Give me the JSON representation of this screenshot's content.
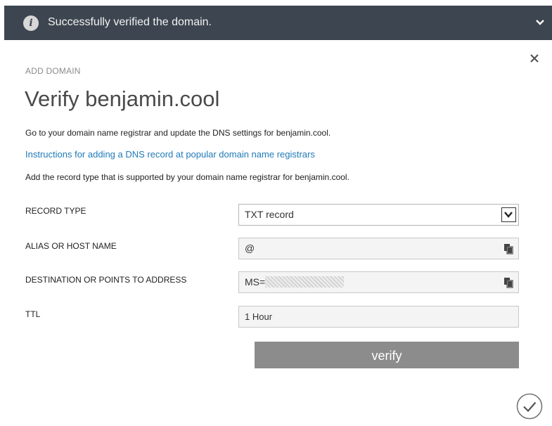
{
  "notification": {
    "message": "Successfully verified the domain.",
    "icon": "info-icon",
    "expand_icon": "chevron-down-icon",
    "background": "#3d4650"
  },
  "dialog": {
    "breadcrumb": "ADD DOMAIN",
    "title": "Verify benjamin.cool",
    "intro": "Go to your domain name registrar and update the DNS settings for benjamin.cool.",
    "instructions_link": "Instructions for adding a DNS record at popular domain name registrars",
    "record_note": "Add the record type that is supported by your domain name registrar for benjamin.cool.",
    "close_icon": "close-icon"
  },
  "form": {
    "record_type": {
      "label": "RECORD TYPE",
      "value": "TXT record"
    },
    "alias": {
      "label": "ALIAS OR HOST NAME",
      "value": "@"
    },
    "destination": {
      "label": "DESTINATION OR POINTS TO ADDRESS",
      "value": "MS="
    },
    "ttl": {
      "label": "TTL",
      "value": "1 Hour"
    }
  },
  "actions": {
    "verify_label": "verify",
    "confirm_icon": "checkmark-circle-icon"
  },
  "colors": {
    "link": "#1f7ab8",
    "button": "#8c8c8c"
  }
}
